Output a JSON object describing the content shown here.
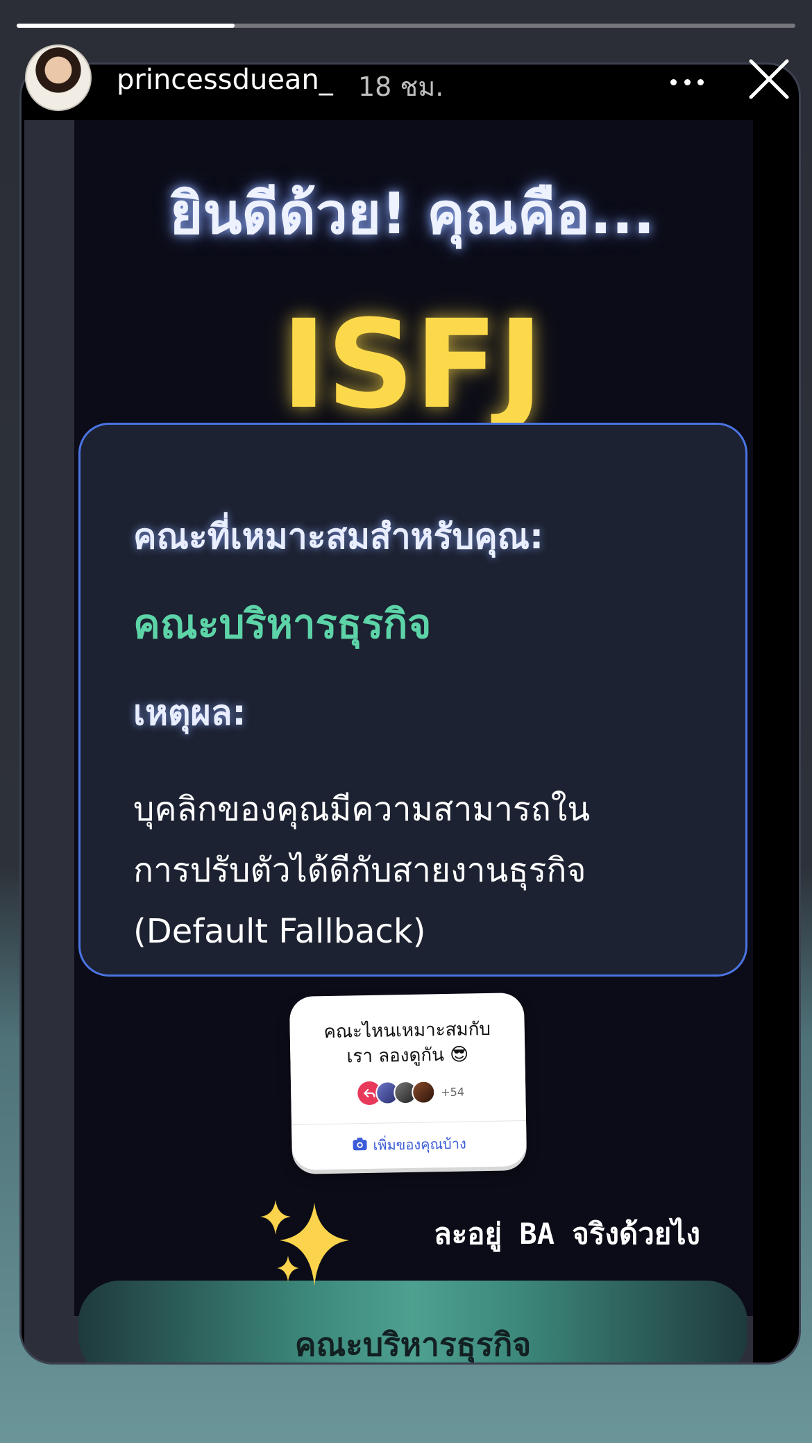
{
  "story": {
    "progress_fraction": 0.28,
    "username": "princessduean_",
    "timestamp": "18 ชม."
  },
  "content": {
    "headline": "ยินดีด้วย! คุณคือ...",
    "result_type": "ISFJ",
    "card": {
      "label": "คณะที่เหมาะสมสำหรับคุณ:",
      "faculty": "คณะบริหารธุรกิจ",
      "reason_label": "เหตุผล:",
      "reason_lines": [
        "บุคลิกของคุณมีความสามารถใน",
        "การปรับตัวได้ดีกับสายงานธุรกิจ",
        "(Default Fallback)"
      ]
    },
    "bottom_button_label": "คณะบริหารธุรกิจ"
  },
  "sticker": {
    "title_lines": [
      "คณะไหนเหมาะสมกับ",
      "เรา ลองดูกัน 😎"
    ],
    "participants": "+54",
    "cta": "เพิ่มของคุณบ้าง"
  },
  "caption": "ละอยู่ BA จริงด้วยไง",
  "icons": {
    "more": "more-horizontal-icon",
    "close": "close-icon",
    "reply": "reply-arrow-icon",
    "camera": "camera-icon",
    "sparkles": "sparkles-icon"
  },
  "colors": {
    "headline_glow": "#eef2ff",
    "result_type": "#fcd94a",
    "faculty": "#5dd4a8",
    "card_border": "#4b74e3",
    "cta": "#3b5bd9",
    "reply_badge": "#e8395b"
  }
}
